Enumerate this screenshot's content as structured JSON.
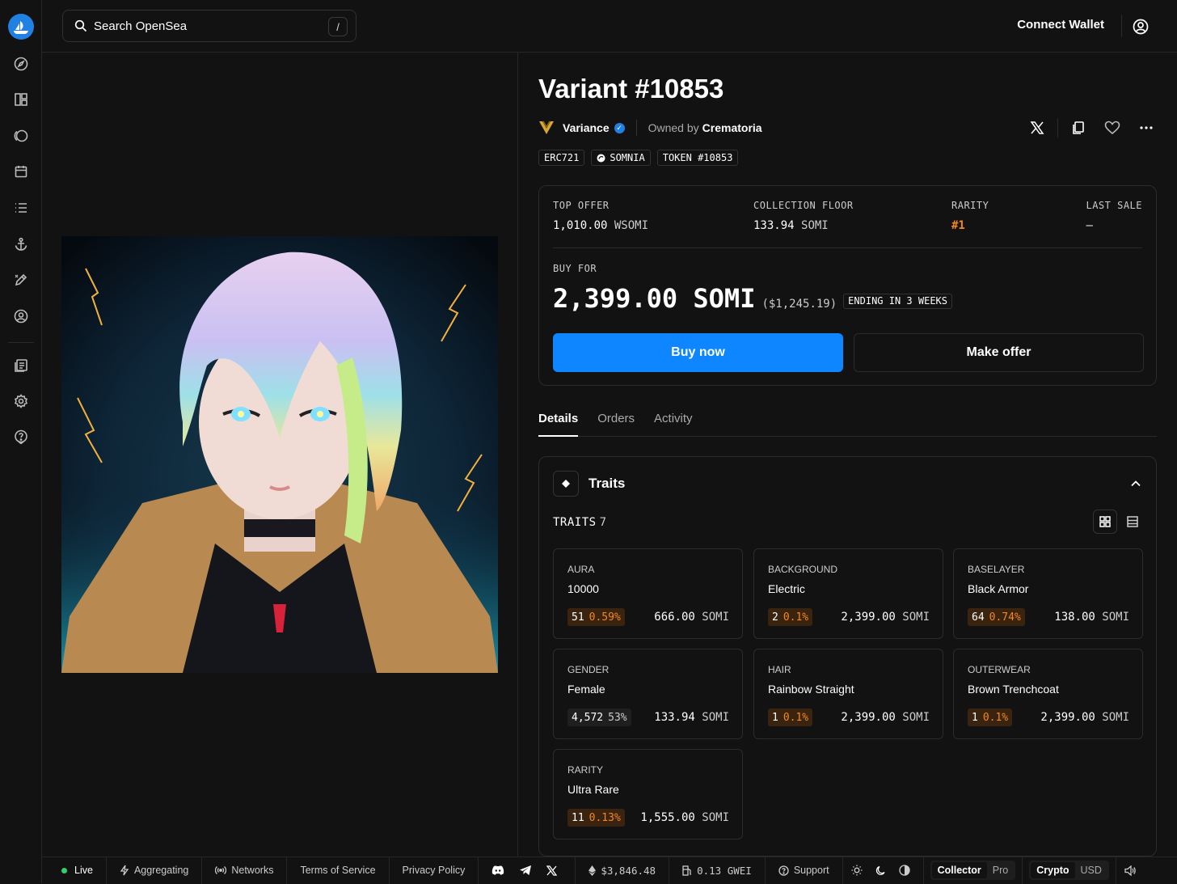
{
  "search": {
    "placeholder": "Search OpenSea",
    "shortcut": "/"
  },
  "header": {
    "connect_label": "Connect Wallet"
  },
  "item": {
    "title": "Variant #10853",
    "collection": "Variance",
    "owned_prefix": "Owned by",
    "owner": "Crematoria",
    "tags": [
      "ERC721",
      "SOMNIA",
      "TOKEN #10853"
    ]
  },
  "stats": {
    "top_offer": {
      "label": "TOP OFFER",
      "amount": "1,010.00",
      "currency": "WSOMI"
    },
    "floor": {
      "label": "COLLECTION FLOOR",
      "amount": "133.94",
      "currency": "SOMI"
    },
    "rarity": {
      "label": "RARITY",
      "value": "#1"
    },
    "last_sale": {
      "label": "LAST SALE",
      "value": "–"
    }
  },
  "buy": {
    "label": "BUY FOR",
    "price": "2,399.00 SOMI",
    "usd": "($1,245.19)",
    "ending": "ENDING IN 3 WEEKS",
    "buy_label": "Buy now",
    "offer_label": "Make offer"
  },
  "tabs": [
    "Details",
    "Orders",
    "Activity"
  ],
  "traits": {
    "title": "Traits",
    "count_label": "TRAITS",
    "count": "7",
    "items": [
      {
        "type": "AURA",
        "value": "10000",
        "count": "51",
        "pct": "0.59%",
        "price": "666.00",
        "currency": "SOMI",
        "rare": true
      },
      {
        "type": "BACKGROUND",
        "value": "Electric",
        "count": "2",
        "pct": "0.1%",
        "price": "2,399.00",
        "currency": "SOMI",
        "rare": true
      },
      {
        "type": "BASELAYER",
        "value": "Black Armor",
        "count": "64",
        "pct": "0.74%",
        "price": "138.00",
        "currency": "SOMI",
        "rare": true
      },
      {
        "type": "GENDER",
        "value": "Female",
        "count": "4,572",
        "pct": "53%",
        "price": "133.94",
        "currency": "SOMI",
        "rare": false
      },
      {
        "type": "HAIR",
        "value": "Rainbow Straight",
        "count": "1",
        "pct": "0.1%",
        "price": "2,399.00",
        "currency": "SOMI",
        "rare": true
      },
      {
        "type": "OUTERWEAR",
        "value": "Brown Trenchcoat",
        "count": "1",
        "pct": "0.1%",
        "price": "2,399.00",
        "currency": "SOMI",
        "rare": true
      },
      {
        "type": "RARITY",
        "value": "Ultra Rare",
        "count": "11",
        "pct": "0.13%",
        "price": "1,555.00",
        "currency": "SOMI",
        "rare": true
      }
    ]
  },
  "footer": {
    "live": "Live",
    "aggregating": "Aggregating",
    "networks": "Networks",
    "terms": "Terms of Service",
    "privacy": "Privacy Policy",
    "eth_price": "$3,846.48",
    "gas": "0.13 GWEI",
    "support": "Support",
    "mode_collector": "Collector",
    "mode_pro": "Pro",
    "cur_crypto": "Crypto",
    "cur_usd": "USD"
  },
  "colors": {
    "accent": "#0e86ff",
    "rarity": "#f5871f",
    "live": "#2fd16b",
    "brand": "#2081e2"
  }
}
